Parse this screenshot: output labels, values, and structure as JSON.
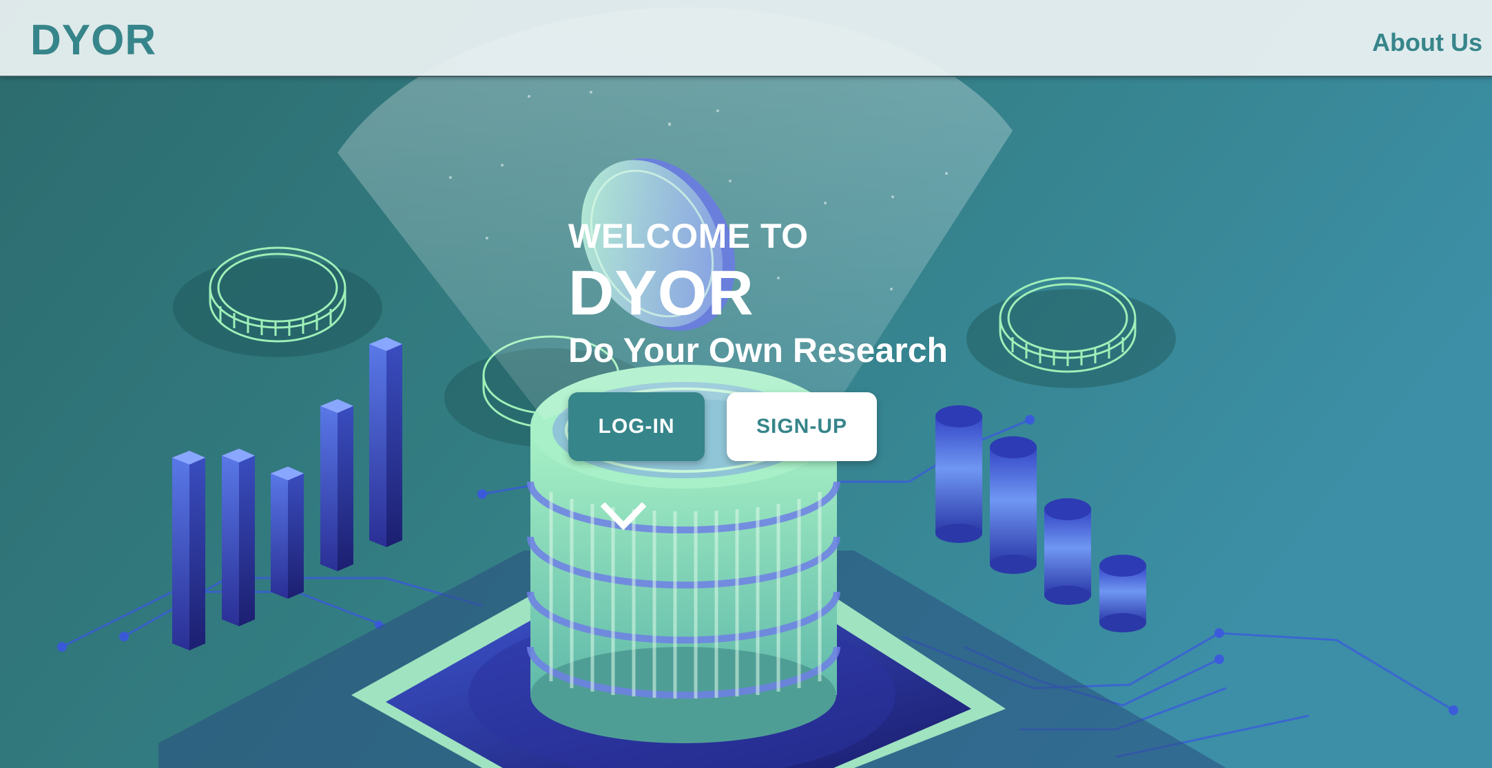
{
  "header": {
    "brand": "DYOR",
    "nav_about": "About Us"
  },
  "hero": {
    "kicker": "WELCOME TO",
    "title": "DYOR",
    "subtitle": "Do Your Own Research",
    "login_label": "LOG-IN",
    "signup_label": "SIGN-UP",
    "scroll_icon": "chevron-down-icon"
  },
  "colors": {
    "brand_teal": "#36858a",
    "header_bg": "#ecf2f3",
    "button_text_light": "#ffffff"
  }
}
